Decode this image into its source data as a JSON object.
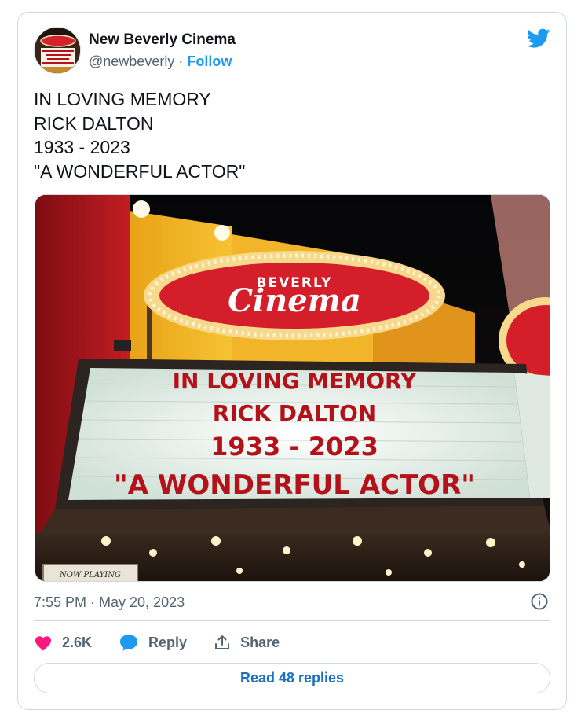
{
  "author": {
    "display_name": "New Beverly Cinema",
    "handle": "@newbeverly",
    "separator": " · ",
    "follow_label": "Follow"
  },
  "tweet": {
    "text": "IN LOVING MEMORY\nRICK DALTON\n1933 - 2023\n\"A WONDERFUL ACTOR\"",
    "timestamp": "7:55 PM · May 20, 2023"
  },
  "photo": {
    "sign_word_top": "BEVERLY",
    "sign_word_script": "Cinema",
    "marquee_lines": [
      "IN LOVING MEMORY",
      "RICK DALTON",
      "1933 - 2023",
      "\"A WONDERFUL ACTOR\""
    ],
    "lower_sign": "NOW PLAYING"
  },
  "actions": {
    "likes": "2.6K",
    "reply_label": "Reply",
    "share_label": "Share"
  },
  "read_replies_label": "Read 48 replies",
  "colors": {
    "accent_blue": "#1d9bf0",
    "like_pink": "#f91880",
    "text_secondary": "#536471",
    "marquee_red": "#b3121b"
  },
  "icons": [
    "twitter-bird-icon",
    "info-icon",
    "heart-icon",
    "reply-bubble-icon",
    "share-upload-icon"
  ]
}
